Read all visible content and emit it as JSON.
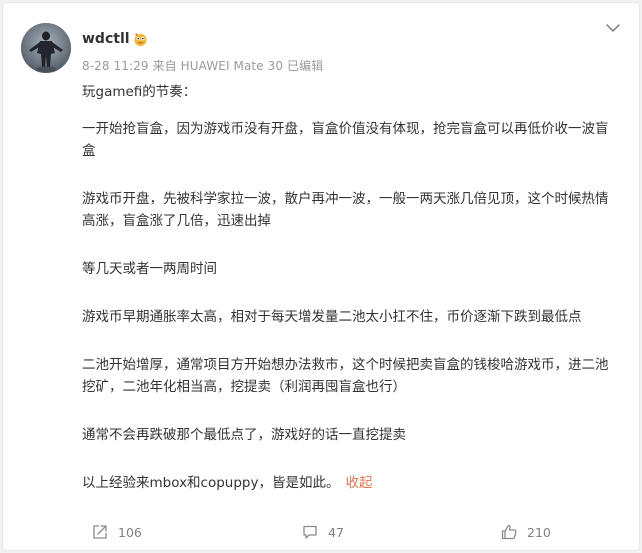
{
  "post": {
    "username": "wdctll",
    "meta": "8-28 11:29 来自 HUAWEI Mate 30 已编辑",
    "paragraphs": [
      "玩gamefi的节奏：",
      "一开始抢盲盒，因为游戏币没有开盘，盲盒价值没有体现，抢完盲盒可以再低价收一波盲盒",
      "游戏币开盘，先被科学家拉一波，散户再冲一波，一般一两天涨几倍见顶，这个时候热情高涨，盲盒涨了几倍，迅速出掉",
      "等几天或者一两周时间",
      "游戏币早期通胀率太高，相对于每天增发量二池太小扛不住，币价逐渐下跌到最低点",
      "二池开始增厚，通常项目方开始想办法救市，这个时候把卖盲盒的钱梭哈游戏币，进二池挖矿，二池年化相当高，挖提卖（利润再囤盲盒也行）",
      "通常不会再跌破那个最低点了，游戏好的话一直挖提卖"
    ],
    "last_paragraph": "以上经验来mbox和copuppy，皆是如此。",
    "collapse_label": "收起",
    "accent_color": "#eb7350"
  },
  "actions": {
    "share_count": "106",
    "comment_count": "47",
    "like_count": "210"
  },
  "icons": {
    "badge": "emoji-badge-icon",
    "menu": "chevron-down-icon",
    "share": "share-icon",
    "comment": "comment-icon",
    "like": "thumbs-up-icon"
  }
}
